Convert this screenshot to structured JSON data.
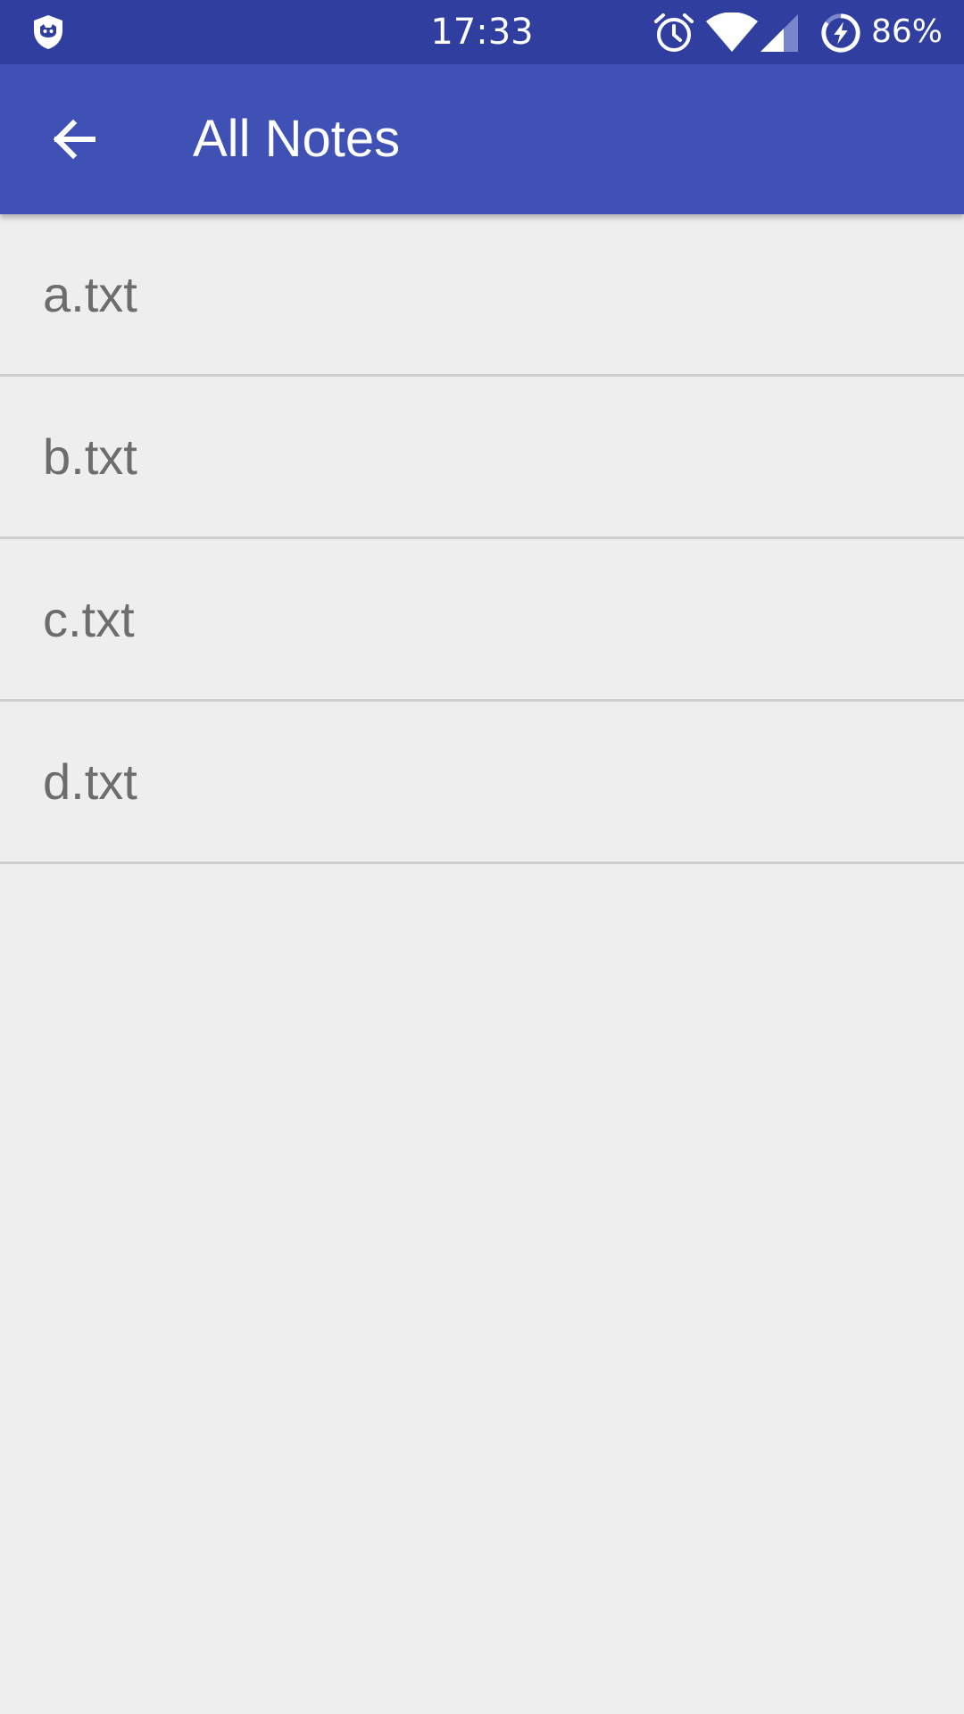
{
  "status_bar": {
    "time": "17:33",
    "battery": "86%",
    "icons": [
      "shield-icon",
      "alarm-icon",
      "wifi-icon",
      "cellular-signal-icon",
      "battery-charging-icon"
    ]
  },
  "app_bar": {
    "title": "All Notes",
    "back_icon": "arrow-left-icon"
  },
  "notes": [
    {
      "label": "a.txt"
    },
    {
      "label": "b.txt"
    },
    {
      "label": "c.txt"
    },
    {
      "label": "d.txt"
    }
  ],
  "colors": {
    "status_bar": "#303f9f",
    "app_bar": "#3f51b5",
    "background": "#eeeeee",
    "item_text": "#6d6d6d",
    "divider": "#cfcfcf"
  }
}
